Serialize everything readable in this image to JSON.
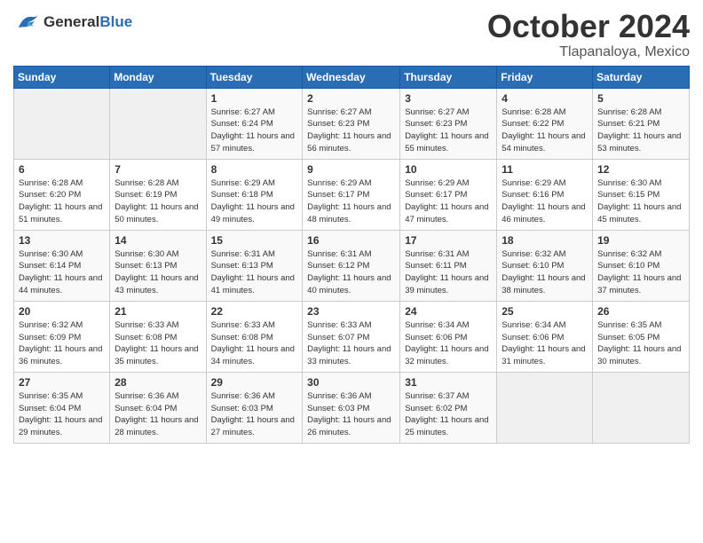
{
  "header": {
    "logo_general": "General",
    "logo_blue": "Blue",
    "month": "October 2024",
    "location": "Tlapanaloya, Mexico"
  },
  "days_of_week": [
    "Sunday",
    "Monday",
    "Tuesday",
    "Wednesday",
    "Thursday",
    "Friday",
    "Saturday"
  ],
  "weeks": [
    [
      {
        "day": "",
        "info": ""
      },
      {
        "day": "",
        "info": ""
      },
      {
        "day": "1",
        "info": "Sunrise: 6:27 AM\nSunset: 6:24 PM\nDaylight: 11 hours and 57 minutes."
      },
      {
        "day": "2",
        "info": "Sunrise: 6:27 AM\nSunset: 6:23 PM\nDaylight: 11 hours and 56 minutes."
      },
      {
        "day": "3",
        "info": "Sunrise: 6:27 AM\nSunset: 6:23 PM\nDaylight: 11 hours and 55 minutes."
      },
      {
        "day": "4",
        "info": "Sunrise: 6:28 AM\nSunset: 6:22 PM\nDaylight: 11 hours and 54 minutes."
      },
      {
        "day": "5",
        "info": "Sunrise: 6:28 AM\nSunset: 6:21 PM\nDaylight: 11 hours and 53 minutes."
      }
    ],
    [
      {
        "day": "6",
        "info": "Sunrise: 6:28 AM\nSunset: 6:20 PM\nDaylight: 11 hours and 51 minutes."
      },
      {
        "day": "7",
        "info": "Sunrise: 6:28 AM\nSunset: 6:19 PM\nDaylight: 11 hours and 50 minutes."
      },
      {
        "day": "8",
        "info": "Sunrise: 6:29 AM\nSunset: 6:18 PM\nDaylight: 11 hours and 49 minutes."
      },
      {
        "day": "9",
        "info": "Sunrise: 6:29 AM\nSunset: 6:17 PM\nDaylight: 11 hours and 48 minutes."
      },
      {
        "day": "10",
        "info": "Sunrise: 6:29 AM\nSunset: 6:17 PM\nDaylight: 11 hours and 47 minutes."
      },
      {
        "day": "11",
        "info": "Sunrise: 6:29 AM\nSunset: 6:16 PM\nDaylight: 11 hours and 46 minutes."
      },
      {
        "day": "12",
        "info": "Sunrise: 6:30 AM\nSunset: 6:15 PM\nDaylight: 11 hours and 45 minutes."
      }
    ],
    [
      {
        "day": "13",
        "info": "Sunrise: 6:30 AM\nSunset: 6:14 PM\nDaylight: 11 hours and 44 minutes."
      },
      {
        "day": "14",
        "info": "Sunrise: 6:30 AM\nSunset: 6:13 PM\nDaylight: 11 hours and 43 minutes."
      },
      {
        "day": "15",
        "info": "Sunrise: 6:31 AM\nSunset: 6:13 PM\nDaylight: 11 hours and 41 minutes."
      },
      {
        "day": "16",
        "info": "Sunrise: 6:31 AM\nSunset: 6:12 PM\nDaylight: 11 hours and 40 minutes."
      },
      {
        "day": "17",
        "info": "Sunrise: 6:31 AM\nSunset: 6:11 PM\nDaylight: 11 hours and 39 minutes."
      },
      {
        "day": "18",
        "info": "Sunrise: 6:32 AM\nSunset: 6:10 PM\nDaylight: 11 hours and 38 minutes."
      },
      {
        "day": "19",
        "info": "Sunrise: 6:32 AM\nSunset: 6:10 PM\nDaylight: 11 hours and 37 minutes."
      }
    ],
    [
      {
        "day": "20",
        "info": "Sunrise: 6:32 AM\nSunset: 6:09 PM\nDaylight: 11 hours and 36 minutes."
      },
      {
        "day": "21",
        "info": "Sunrise: 6:33 AM\nSunset: 6:08 PM\nDaylight: 11 hours and 35 minutes."
      },
      {
        "day": "22",
        "info": "Sunrise: 6:33 AM\nSunset: 6:08 PM\nDaylight: 11 hours and 34 minutes."
      },
      {
        "day": "23",
        "info": "Sunrise: 6:33 AM\nSunset: 6:07 PM\nDaylight: 11 hours and 33 minutes."
      },
      {
        "day": "24",
        "info": "Sunrise: 6:34 AM\nSunset: 6:06 PM\nDaylight: 11 hours and 32 minutes."
      },
      {
        "day": "25",
        "info": "Sunrise: 6:34 AM\nSunset: 6:06 PM\nDaylight: 11 hours and 31 minutes."
      },
      {
        "day": "26",
        "info": "Sunrise: 6:35 AM\nSunset: 6:05 PM\nDaylight: 11 hours and 30 minutes."
      }
    ],
    [
      {
        "day": "27",
        "info": "Sunrise: 6:35 AM\nSunset: 6:04 PM\nDaylight: 11 hours and 29 minutes."
      },
      {
        "day": "28",
        "info": "Sunrise: 6:36 AM\nSunset: 6:04 PM\nDaylight: 11 hours and 28 minutes."
      },
      {
        "day": "29",
        "info": "Sunrise: 6:36 AM\nSunset: 6:03 PM\nDaylight: 11 hours and 27 minutes."
      },
      {
        "day": "30",
        "info": "Sunrise: 6:36 AM\nSunset: 6:03 PM\nDaylight: 11 hours and 26 minutes."
      },
      {
        "day": "31",
        "info": "Sunrise: 6:37 AM\nSunset: 6:02 PM\nDaylight: 11 hours and 25 minutes."
      },
      {
        "day": "",
        "info": ""
      },
      {
        "day": "",
        "info": ""
      }
    ]
  ]
}
